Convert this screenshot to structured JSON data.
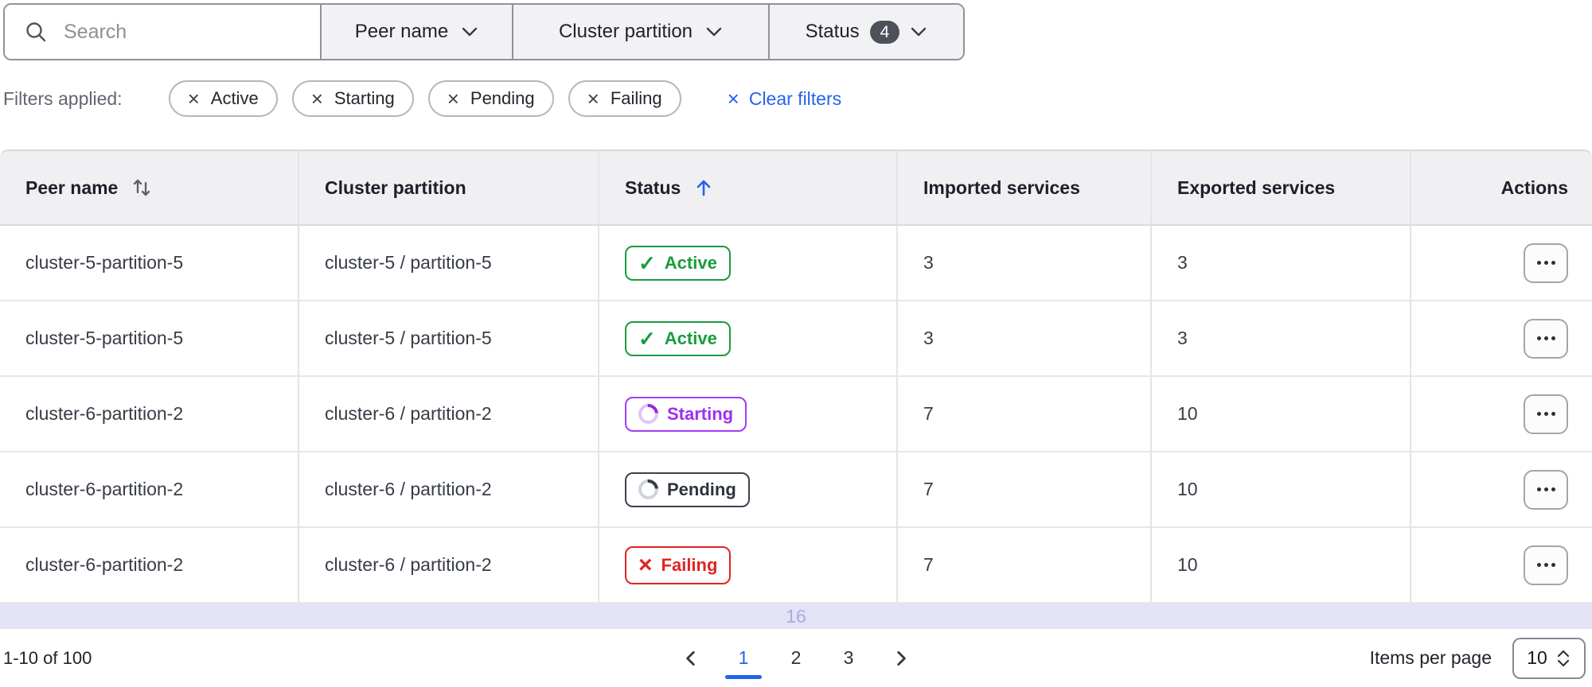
{
  "toolbar": {
    "search": {
      "placeholder": "Search"
    },
    "filters": [
      {
        "label": "Peer name"
      },
      {
        "label": "Cluster partition"
      },
      {
        "label": "Status",
        "badge_count": "4"
      }
    ]
  },
  "applied_filters": {
    "label": "Filters applied:",
    "chips": [
      "Active",
      "Starting",
      "Pending",
      "Failing"
    ],
    "clear_label": "Clear filters"
  },
  "table": {
    "columns": [
      {
        "label": "Peer name",
        "sort": "both"
      },
      {
        "label": "Cluster partition",
        "sort": "none"
      },
      {
        "label": "Status",
        "sort": "asc"
      },
      {
        "label": "Imported services",
        "sort": "none"
      },
      {
        "label": "Exported services",
        "sort": "none"
      },
      {
        "label": "Actions",
        "sort": "none"
      }
    ],
    "rows": [
      {
        "peer_name": "cluster-5-partition-5",
        "cluster_partition": "cluster-5 / partition-5",
        "status": "Active",
        "status_class": "badge badge-active",
        "imported_services": "3",
        "exported_services": "3"
      },
      {
        "peer_name": "cluster-5-partition-5",
        "cluster_partition": "cluster-5 / partition-5",
        "status": "Active",
        "status_class": "badge badge-active",
        "imported_services": "3",
        "exported_services": "3"
      },
      {
        "peer_name": "cluster-6-partition-2",
        "cluster_partition": "cluster-6 / partition-2",
        "status": "Starting",
        "status_class": "badge badge-starting",
        "imported_services": "7",
        "exported_services": "10"
      },
      {
        "peer_name": "cluster-6-partition-2",
        "cluster_partition": "cluster-6 / partition-2",
        "status": "Pending",
        "status_class": "badge badge-pending",
        "imported_services": "7",
        "exported_services": "10"
      },
      {
        "peer_name": "cluster-6-partition-2",
        "cluster_partition": "cluster-6 / partition-2",
        "status": "Failing",
        "status_class": "badge badge-failing",
        "imported_services": "7",
        "exported_services": "10"
      }
    ],
    "overflow_row": {
      "value": "16"
    }
  },
  "pagination": {
    "range": "1-10 of 100",
    "pages": [
      "1",
      "2",
      "3"
    ],
    "current_page": "1",
    "items_per_page_label": "Items per page",
    "items_per_page_value": "10"
  },
  "colors": {
    "accent_blue": "#2563eb",
    "active_green": "#189c3d",
    "starting_purple": "#a43bf2",
    "failing_red": "#e02424",
    "pending_dark": "#3d4350",
    "overflow_lavender": "#e3e3f5",
    "header_gray": "#f0f0f2",
    "count_badge_gray": "#4d525a"
  }
}
